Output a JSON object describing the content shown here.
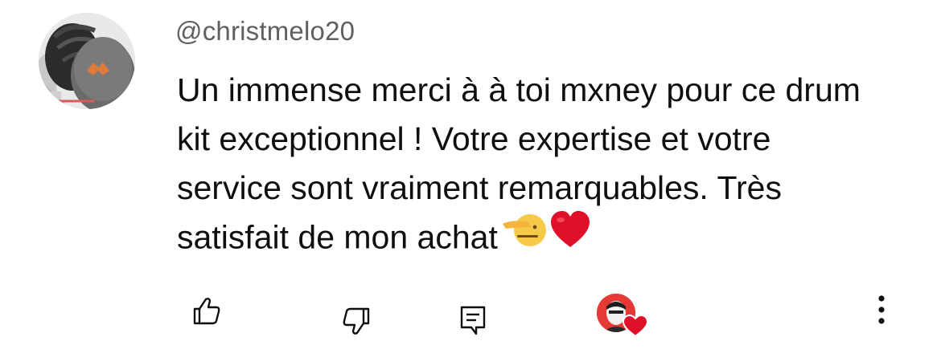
{
  "comment": {
    "username": "@christmelo20",
    "text_lines": [
      "Un immense merci à à toi mxney pour ce drum",
      "kit exceptionnel ! Votre expertise et votre",
      "service sont vraiment remarquables. Très",
      "satisfait de mon achat"
    ],
    "emojis": [
      "saluting-face",
      "red-heart"
    ]
  },
  "actions": {
    "icons": [
      "thumbs-up-icon",
      "thumbs-down-icon",
      "reply-icon",
      "creator-heart-icon",
      "more-vertical-icon"
    ]
  },
  "colors": {
    "username": "#606060",
    "text": "#0f0f0f",
    "heart": "#e0102a",
    "creator_avatar_bg": "#e53935"
  }
}
